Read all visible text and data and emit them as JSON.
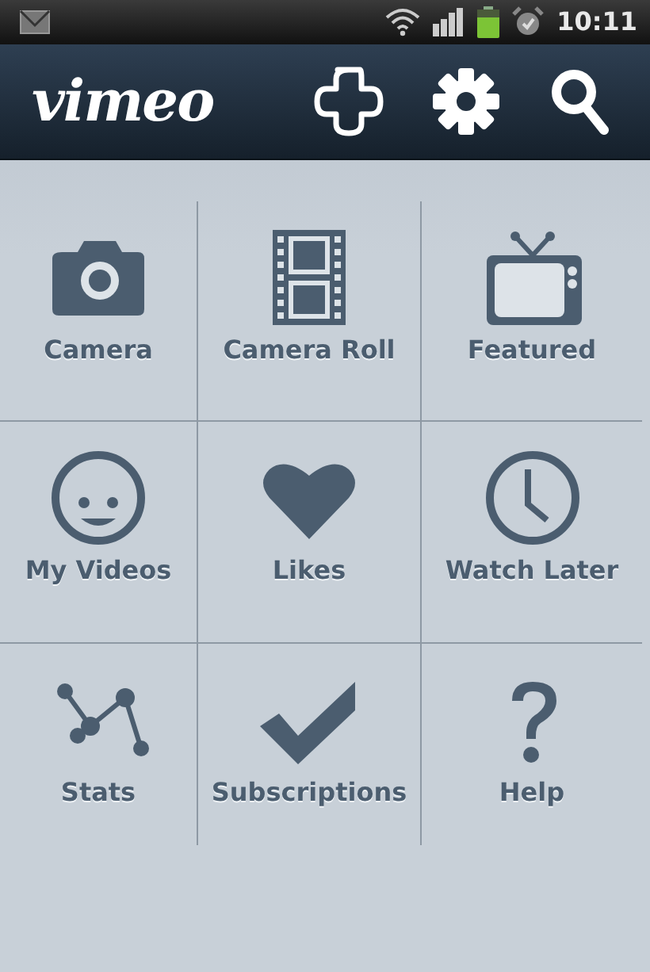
{
  "status_bar": {
    "time": "10:11"
  },
  "app_bar": {
    "logo": "vimeo"
  },
  "menu": [
    {
      "label": "Camera",
      "kind": "camera"
    },
    {
      "label": "Camera Roll",
      "kind": "film"
    },
    {
      "label": "Featured",
      "kind": "tv"
    },
    {
      "label": "My Videos",
      "kind": "smiley"
    },
    {
      "label": "Likes",
      "kind": "heart"
    },
    {
      "label": "Watch Later",
      "kind": "clock"
    },
    {
      "label": "Stats",
      "kind": "stats"
    },
    {
      "label": "Subscriptions",
      "kind": "check"
    },
    {
      "label": "Help",
      "kind": "help"
    }
  ]
}
